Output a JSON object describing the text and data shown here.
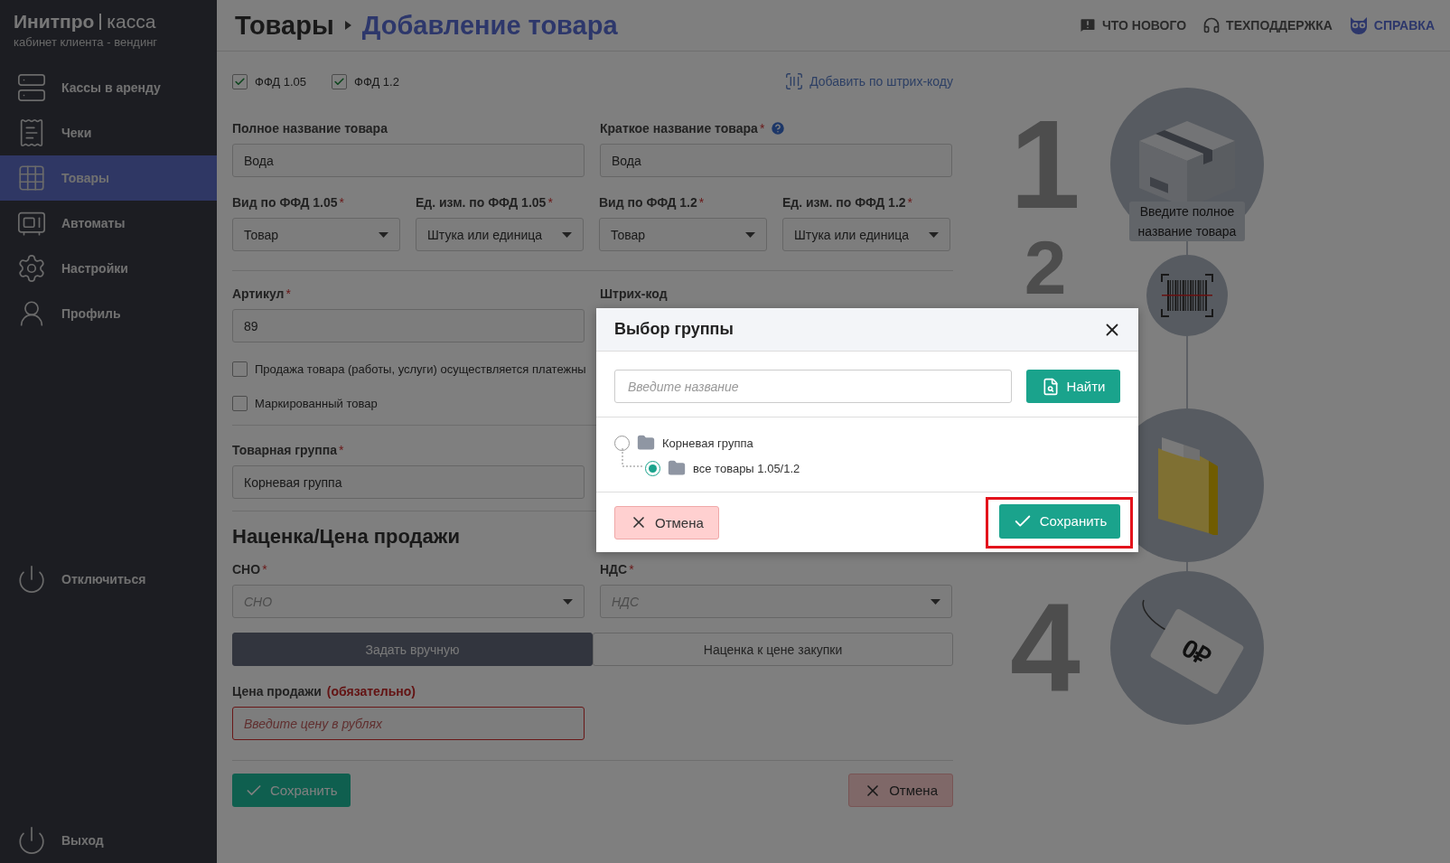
{
  "sidebar": {
    "brand": "Инитпро",
    "product": "касса",
    "subtitle": "кабинет клиента - вендинг",
    "items": [
      {
        "kind": "registers",
        "label": "Кассы в аренду",
        "selected": false
      },
      {
        "kind": "receipts",
        "label": "Чеки",
        "selected": false
      },
      {
        "kind": "products",
        "label": "Товары",
        "selected": true
      },
      {
        "kind": "machines",
        "label": "Автоматы",
        "selected": false
      },
      {
        "kind": "settings",
        "label": "Настройки",
        "selected": false
      },
      {
        "kind": "profile",
        "label": "Профиль",
        "selected": false
      }
    ],
    "disconnect": "Отключиться",
    "logout": "Выход"
  },
  "header": {
    "section": "Товары",
    "page": "Добавление товара",
    "links": [
      {
        "kind": "news",
        "label": "ЧТО НОВОГО"
      },
      {
        "kind": "support",
        "label": "ТЕХПОДДЕРЖКА"
      },
      {
        "kind": "help",
        "label": "СПРАВКА"
      }
    ]
  },
  "form": {
    "ffd": [
      {
        "label": "ФФД 1.05",
        "checked": true
      },
      {
        "label": "ФФД 1.2",
        "checked": true
      }
    ],
    "barcode_link": "Добавить по штрих-коду",
    "name_fields": [
      {
        "label": "Полное название товара",
        "value": "Вода",
        "help": false
      },
      {
        "label": "Краткое название товара",
        "mark": "*",
        "value": "Вода",
        "help": true
      }
    ],
    "type_selects": [
      {
        "label": "Вид по ФФД 1.05",
        "mark": "*",
        "value": "Товар"
      },
      {
        "label": "Ед. изм. по ФФД 1.05",
        "mark": "*",
        "value": "Штука или единица"
      },
      {
        "label": "Вид по ФФД 1.2",
        "mark": "*",
        "value": "Товар"
      },
      {
        "label": "Ед. изм. по ФФД 1.2",
        "mark": "*",
        "value": "Штука или единица"
      }
    ],
    "article": {
      "label": "Артикул",
      "mark": "*",
      "value": "89"
    },
    "barcode_label": "Штрих-код",
    "options": [
      {
        "label": "Продажа товара (работы, услуги) осуществляется платежны",
        "checked": false
      },
      {
        "label": "Маркированный товар",
        "checked": false
      }
    ],
    "group": {
      "label": "Товарная группа",
      "mark": "*",
      "value": "Корневая группа"
    },
    "pricing_title": "Наценка/Цена продажи",
    "tax_selects": [
      {
        "label": "СНО",
        "mark": "*",
        "placeholder": "СНО"
      },
      {
        "label": "НДС",
        "mark": "*",
        "placeholder": "НДС"
      }
    ],
    "price_modes": [
      {
        "label": "Задать вручную",
        "selected": true
      },
      {
        "label": "Наценка к цене закупки",
        "selected": false
      }
    ],
    "price": {
      "label": "Цена продажи",
      "note": "(обязательно)",
      "placeholder": "Введите цену в рублях",
      "error": true
    },
    "save": "Сохранить",
    "cancel": "Отмена"
  },
  "steps": [
    {
      "kind": "box",
      "number": "1",
      "hint": "Введите полное название товара"
    },
    {
      "kind": "barcode",
      "number": "2"
    },
    {
      "kind": "folder"
    },
    {
      "kind": "tag",
      "number": "4",
      "tag_text": "0₽"
    }
  ],
  "modal": {
    "title": "Выбор группы",
    "search_placeholder": "Введите название",
    "find": "Найти",
    "tree": [
      {
        "label": "Корневая группа",
        "selected": false,
        "children": [
          {
            "label": "все товары 1.05/1.2",
            "selected": true
          }
        ]
      }
    ],
    "cancel": "Отмена",
    "save": "Сохранить",
    "save_highlighted": true
  }
}
